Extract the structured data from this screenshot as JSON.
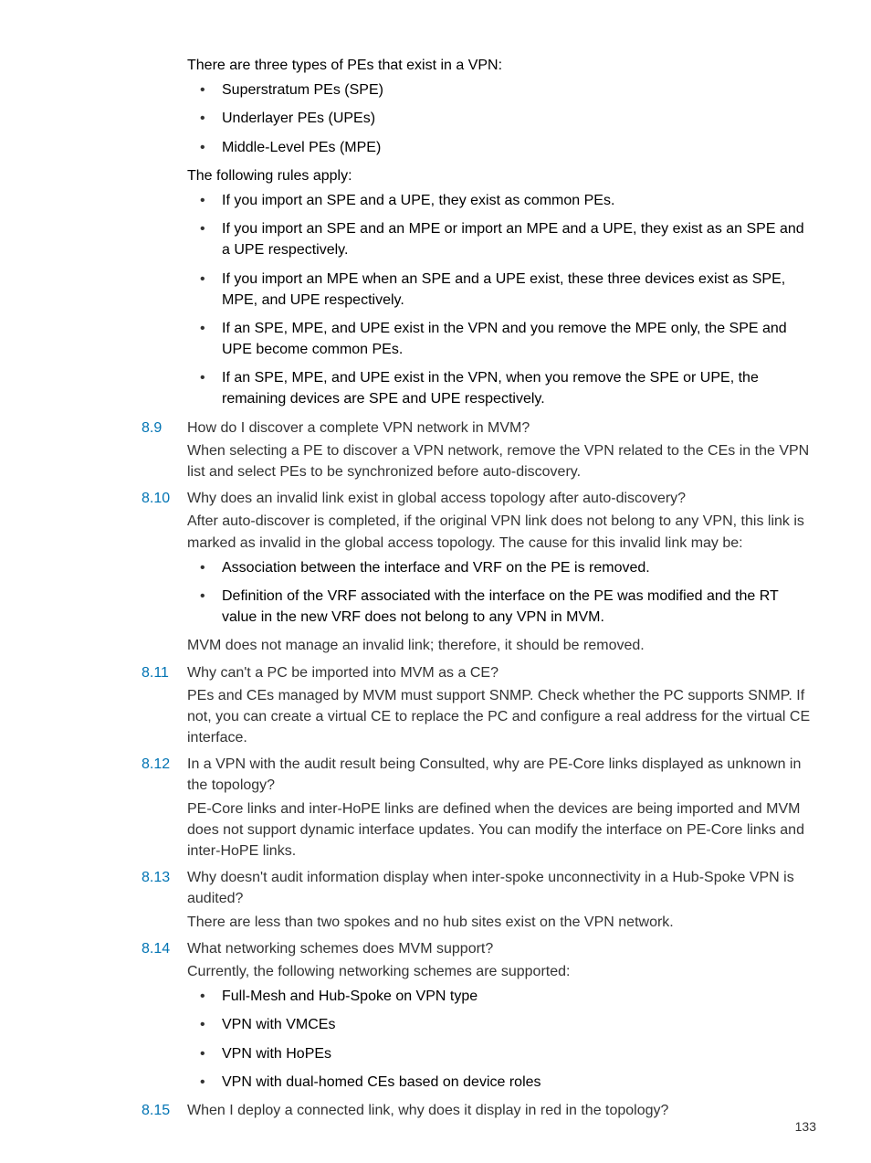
{
  "intro": {
    "p1": "There are three types of PEs that exist in a VPN:",
    "list1": [
      "Superstratum PEs (SPE)",
      "Underlayer PEs (UPEs)",
      "Middle-Level PEs (MPE)"
    ],
    "p2": "The following rules apply:",
    "list2": [
      "If you import an SPE and a UPE, they exist as common PEs.",
      "If you import an SPE and an MPE or import an MPE and a UPE, they exist as an SPE and a UPE respectively.",
      "If you import an MPE when an SPE and a UPE exist, these three devices exist as SPE, MPE, and UPE respectively.",
      "If an SPE, MPE, and UPE exist in the VPN and you remove the MPE only, the SPE and UPE become common PEs.",
      "If an SPE, MPE, and UPE exist in the VPN, when you remove the SPE or UPE, the remaining devices are SPE and UPE respectively."
    ]
  },
  "faqs": [
    {
      "num": "8.9",
      "q": "How do I discover a complete VPN network in MVM?",
      "a": "When selecting a PE to discover a VPN network, remove the VPN related to the CEs in the VPN list and select PEs to be synchronized before auto-discovery."
    },
    {
      "num": "8.10",
      "q": "Why does an invalid link exist in global access topology after auto-discovery?",
      "a": "After auto-discover is completed, if the original VPN link does not belong to any VPN, this link is marked as invalid in the global access topology. The cause for this invalid link may be:",
      "bullets": [
        "Association between the interface and VRF on the PE is removed.",
        "Definition of the VRF associated with the interface on the PE was modified and the RT value in the new VRF does not belong to any VPN in MVM."
      ],
      "a2": "MVM does not manage an invalid link; therefore, it should be removed."
    },
    {
      "num": "8.11",
      "q": "Why can't a PC be imported into MVM as a CE?",
      "a": "PEs and CEs managed by MVM must support SNMP. Check whether the PC supports SNMP. If not, you can create a virtual CE to replace the PC and configure a real address for the virtual CE interface."
    },
    {
      "num": "8.12",
      "q": "In a VPN with the audit result being Consulted, why are PE-Core links displayed as unknown in the topology?",
      "a": "PE-Core links and inter-HoPE links are defined when the devices are being imported and MVM does not support dynamic interface updates. You can modify the interface on PE-Core links and inter-HoPE links."
    },
    {
      "num": "8.13",
      "q": "Why doesn't audit information display when inter-spoke unconnectivity in a Hub-Spoke VPN is audited?",
      "a": "There are less than two spokes and no hub sites exist on the VPN network."
    },
    {
      "num": "8.14",
      "q": "What networking schemes does MVM support?",
      "a": "Currently, the following networking schemes are supported:",
      "bullets": [
        "Full-Mesh and Hub-Spoke on VPN type",
        "VPN with VMCEs",
        "VPN with HoPEs",
        "VPN with dual-homed CEs based on device roles"
      ]
    },
    {
      "num": "8.15",
      "q": "When I deploy a connected link, why does it display in red in the topology?"
    }
  ],
  "pageNumber": "133"
}
